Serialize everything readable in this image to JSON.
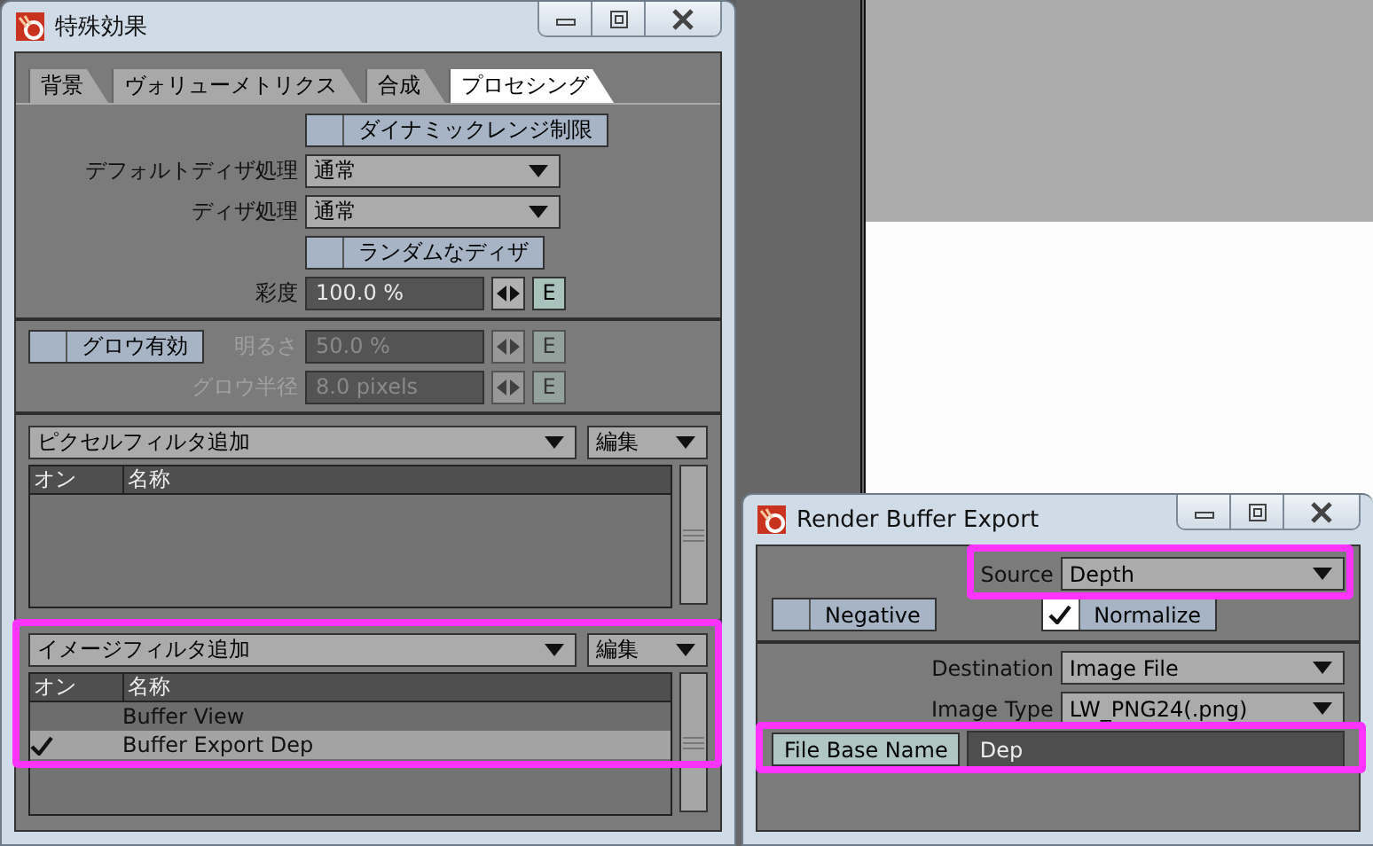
{
  "fx_window": {
    "title": "特殊効果",
    "tabs": [
      {
        "label": "背景",
        "selected": false
      },
      {
        "label": "ヴォリューメトリクス",
        "selected": false
      },
      {
        "label": "合成",
        "selected": false
      },
      {
        "label": "プロセシング",
        "selected": true
      }
    ],
    "processing": {
      "dynamic_range": {
        "label": "ダイナミックレンジ制限",
        "checked": false
      },
      "default_dither": {
        "label": "デフォルトディザ処理",
        "value": "通常"
      },
      "dither": {
        "label": "ディザ処理",
        "value": "通常"
      },
      "random_dither": {
        "label": "ランダムなディザ",
        "checked": false
      },
      "saturation": {
        "label": "彩度",
        "value": "100.0 %",
        "envelope": "E",
        "disabled": false
      }
    },
    "glow": {
      "enable": {
        "label": "グロウ有効",
        "checked": false
      },
      "fields": [
        {
          "label": "明るさ",
          "value": "50.0 %",
          "envelope": "E",
          "disabled": true
        },
        {
          "label": "グロウ半径",
          "value": "8.0 pixels",
          "envelope": "E",
          "disabled": true
        }
      ]
    },
    "pixel_filters": {
      "add": "ピクセルフィルタ追加",
      "edit": "編集",
      "columns": [
        "オン",
        "名称"
      ]
    },
    "image_filters": {
      "add": "イメージフィルタ追加",
      "edit": "編集",
      "columns": [
        "オン",
        "名称"
      ],
      "rows": [
        {
          "on": false,
          "name": "Buffer View",
          "selected": false
        },
        {
          "on": true,
          "name": "Buffer Export Dep",
          "selected": true
        }
      ]
    }
  },
  "export_window": {
    "title": "Render Buffer Export",
    "source": {
      "label": "Source",
      "value": "Depth"
    },
    "negative": {
      "label": "Negative",
      "checked": false
    },
    "normalize": {
      "label": "Normalize",
      "checked": true
    },
    "destination": {
      "label": "Destination",
      "value": "Image File"
    },
    "image_type": {
      "label": "Image Type",
      "value": "LW_PNG24(.png)"
    },
    "file_base_name": {
      "label": "File Base Name",
      "value": "Dep"
    }
  }
}
